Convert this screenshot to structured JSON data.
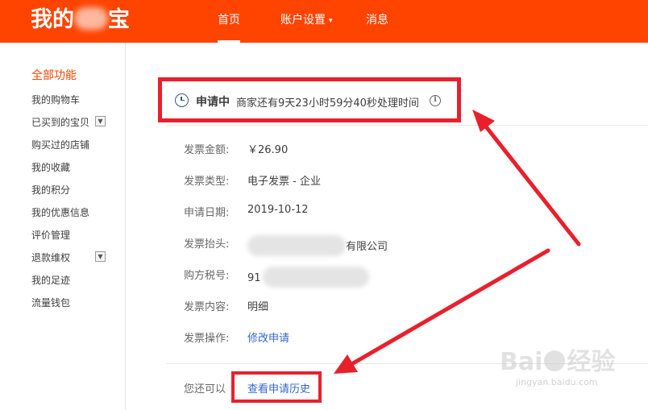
{
  "header": {
    "logo_left": "我的",
    "logo_right": "宝",
    "nav": [
      {
        "label": "首页",
        "active": true
      },
      {
        "label": "账户设置",
        "has_caret": true
      },
      {
        "label": "消息"
      }
    ],
    "caret": "▾",
    "bg_color": "#ff4400"
  },
  "sidebar": {
    "heading": "全部功能",
    "items": [
      {
        "label": "我的购物车"
      },
      {
        "label": "已买到的宝贝",
        "expand": true
      },
      {
        "label": "购买过的店铺"
      },
      {
        "label": "我的收藏"
      },
      {
        "label": "我的积分"
      },
      {
        "label": "我的优惠信息"
      },
      {
        "label": "评价管理"
      },
      {
        "label": "退款维权",
        "expand": true
      },
      {
        "label": "我的足迹"
      },
      {
        "label": "流量钱包"
      }
    ],
    "expand_icon": "▼"
  },
  "status": {
    "icon": "clock-icon",
    "title": "申请中",
    "description": "商家还有9天23小时59分40秒处理时间",
    "info_icon": "i"
  },
  "invoice": {
    "rows": [
      {
        "label": "发票金额:",
        "value": "￥26.90"
      },
      {
        "label": "发票类型:",
        "value": "电子发票 - 企业"
      },
      {
        "label": "申请日期:",
        "value": "2019-10-12"
      },
      {
        "label": "发票抬头:",
        "value": "有限公司"
      },
      {
        "label": "购方税号:",
        "value": "91"
      },
      {
        "label": "发票内容:",
        "value": "明细"
      },
      {
        "label": "发票操作:",
        "value": "修改申请"
      }
    ]
  },
  "footer": {
    "prompt": "您还可以",
    "history_link": "查看申请历史"
  },
  "watermark": {
    "main_left": "Bai",
    "main_right": "经验",
    "sub": "jingyan.baidu.com"
  },
  "colors": {
    "accent": "#ff4400",
    "highlight_red": "#e8202c",
    "link": "#3366cc"
  }
}
